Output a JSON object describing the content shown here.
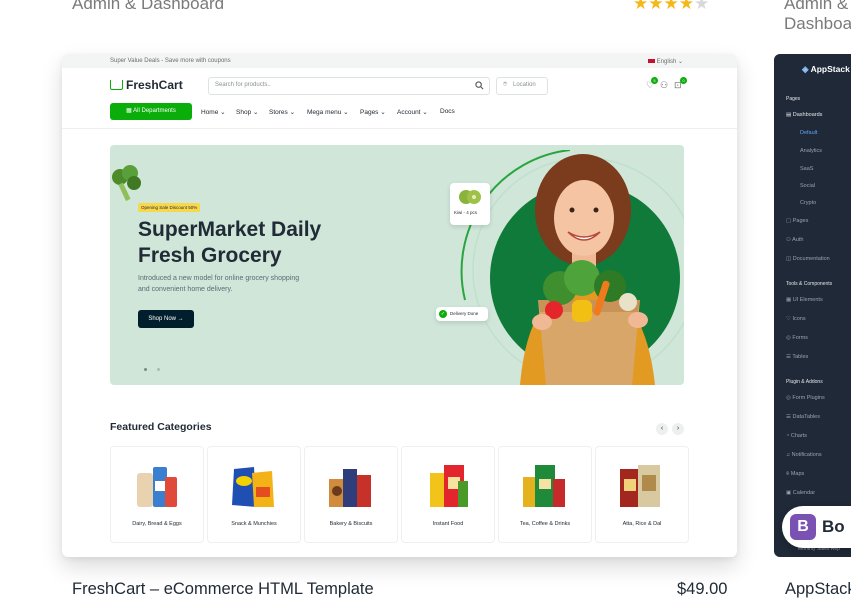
{
  "listing": {
    "prev_category_left": "Admin & Dashboard",
    "prev_category_right": "Admin & Dashboard",
    "rating": 4,
    "rating_max": 5
  },
  "product": {
    "title": "FreshCart – eCommerce HTML Template",
    "price": "$49.00"
  },
  "preview": {
    "topbar_text": "Super Value Deals - Save more with coupons",
    "language": "English",
    "brand": "FreshCart",
    "search_placeholder": "Search for products..",
    "location_label": "Location",
    "cart_count": "0",
    "wishlist_count": "5",
    "departments_label": "All Departments",
    "menu": [
      "Home",
      "Shop",
      "Stores",
      "Mega menu",
      "Pages",
      "Account",
      "Docs"
    ],
    "hero": {
      "badge": "Opening Sale Discount 50%",
      "title_line1": "SuperMarket Daily",
      "title_line2": "Fresh Grocery",
      "subtitle_line1": "Introduced a new model for online grocery shopping",
      "subtitle_line2": "and convenient home delivery.",
      "cta": "Shop Now",
      "product_card_label": "Kiwi - 4 pcs",
      "delivery_label": "Delivery Done"
    },
    "featured_title": "Featured Categories",
    "categories": [
      "Dairy, Bread & Eggs",
      "Snack & Munchies",
      "Bakery & Biscuits",
      "Instant Food",
      "Tea, Coffee & Drinks",
      "Atta, Rice & Dal"
    ],
    "accent_color": "#0aad0a",
    "hero_bg": "#cfe6d9"
  },
  "product2": {
    "title": "AppStack",
    "brand": "AppStack",
    "sidebar": {
      "pages_header": "Pages",
      "items": [
        "Dashboards",
        "Default",
        "Analytics",
        "SaaS",
        "Social",
        "Crypto",
        "Pages",
        "Auth",
        "Documentation"
      ],
      "tools_header": "Tools & Components",
      "tools": [
        "UI Elements",
        "Icons",
        "Forms",
        "Tables"
      ],
      "plugins_header": "Plugin & Addons",
      "plugins": [
        "Form Plugins",
        "DataTables",
        "Charts",
        "Notifications",
        "Maps",
        "Calendar"
      ],
      "footer_text": "Monthly Sales Rep"
    },
    "badge_letter": "B",
    "badge_text": "Bo"
  }
}
